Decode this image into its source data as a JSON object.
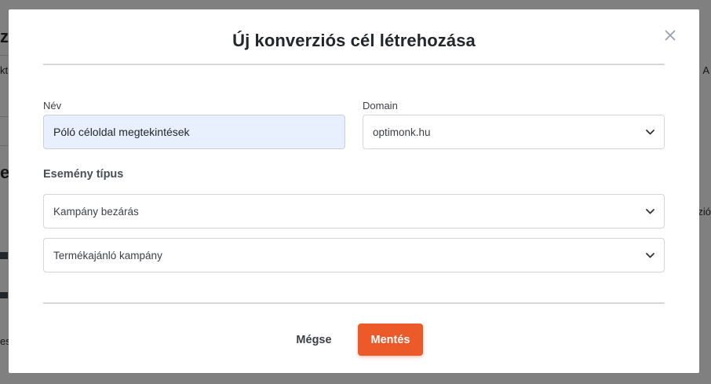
{
  "background": {
    "frag_left_1": "z",
    "frag_left_2": "kt",
    "frag_left_3": "es",
    "frag_left_4": "es",
    "frag_right_1": "A",
    "frag_right_2": "zió"
  },
  "modal": {
    "title": "Új konverziós cél létrehozása",
    "close_icon": "close-icon",
    "name_label": "Név",
    "name_value": "Póló céloldal megtekintések",
    "domain_label": "Domain",
    "domain_value": "optimonk.hu",
    "event_type_label": "Esemény típus",
    "event_select_1": "Kampány bezárás",
    "event_select_2": "Termékajánló kampány",
    "cancel_label": "Mégse",
    "save_label": "Mentés"
  },
  "colors": {
    "accent": "#ed5a29",
    "input_autofill_bg": "#e8f0fe"
  }
}
